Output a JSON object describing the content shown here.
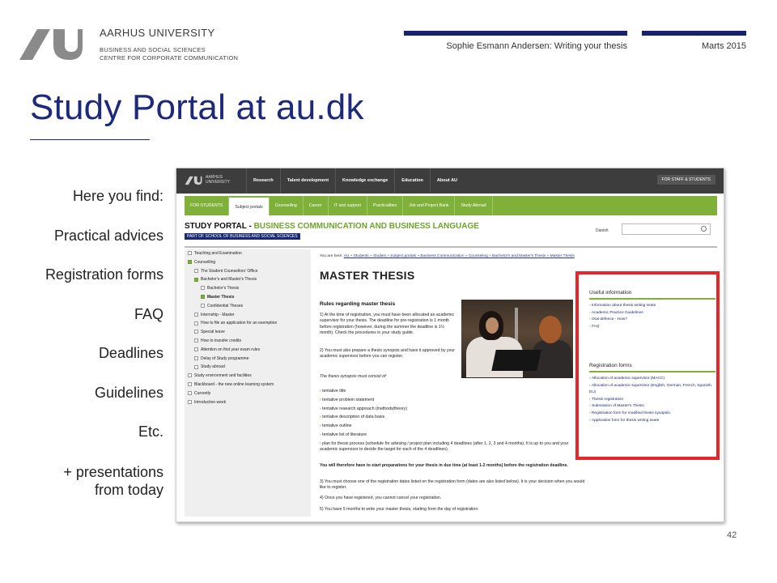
{
  "header": {
    "university": "AARHUS UNIVERSITY",
    "faculty_line1": "BUSINESS AND SOCIAL SCIENCES",
    "faculty_line2": "CENTRE FOR CORPORATE COMMUNICATION",
    "presenter": "Sophie Esmann Andersen: Writing your thesis",
    "date": "Marts 2015",
    "accent_color": "#15236e"
  },
  "slide": {
    "title": "Study Portal at au.dk",
    "title_color": "#1d2a7c",
    "page_number": "42",
    "highlight_color": "#e8262a"
  },
  "side_list": {
    "items": [
      "Here you find:",
      "Practical advices",
      "Registration forms",
      "FAQ",
      "Deadlines",
      "Guidelines",
      "Etc."
    ],
    "extra_line1": "+ presentations",
    "extra_line2": "from today"
  },
  "screenshot": {
    "uni_line1": "AARHUS",
    "uni_line2": "UNIVERSITY",
    "top_nav": [
      "Research",
      "Talent development",
      "Knowledge exchange",
      "Education",
      "About AU"
    ],
    "staff_link": "FOR STAFF & STUDENTS",
    "green_tabs": [
      "FOR STUDENTS",
      "Subject portals",
      "Counselling",
      "Career",
      "IT and support",
      "Practicalities",
      "Job and Project Bank",
      "Study Abroad"
    ],
    "active_tab_index": 1,
    "portal_prefix": "STUDY PORTAL - ",
    "portal_name": "BUSINESS COMMUNICATION AND BUSINESS LANGUAGE",
    "portal_sub": "PART OF SCHOOL OF BUSINESS AND SOCIAL SCIENCES",
    "lang_link": "Danish",
    "left_nav": [
      {
        "label": "Teaching and Examination",
        "indent": 0,
        "checked": false,
        "bold": false
      },
      {
        "label": "Counselling",
        "indent": 0,
        "checked": true,
        "bold": false
      },
      {
        "label": "The Student Counsellors' Office",
        "indent": 1,
        "checked": false,
        "bold": false
      },
      {
        "label": "Bachelor's and Master's Thesis",
        "indent": 1,
        "checked": true,
        "bold": false
      },
      {
        "label": "Bachelor's Thesis",
        "indent": 2,
        "checked": false,
        "bold": false
      },
      {
        "label": "Master Thesis",
        "indent": 2,
        "checked": true,
        "bold": true
      },
      {
        "label": "Confidential Theses",
        "indent": 2,
        "checked": false,
        "bold": false
      },
      {
        "label": "Internship - Master",
        "indent": 1,
        "checked": false,
        "bold": false
      },
      {
        "label": "How to file an application for an exemption",
        "indent": 1,
        "checked": false,
        "bold": false
      },
      {
        "label": "Special leave",
        "indent": 1,
        "checked": false,
        "bold": false
      },
      {
        "label": "How to transfer credits",
        "indent": 1,
        "checked": false,
        "bold": false
      },
      {
        "label": "Attention on first year exam rules",
        "indent": 1,
        "checked": false,
        "bold": false
      },
      {
        "label": "Delay of Study programme",
        "indent": 1,
        "checked": false,
        "bold": false
      },
      {
        "label": "Study abroad",
        "indent": 1,
        "checked": false,
        "bold": false
      },
      {
        "label": "Study environment and facilities",
        "indent": 0,
        "checked": false,
        "bold": false
      },
      {
        "label": "Blackboard - the new online learning system",
        "indent": 0,
        "checked": false,
        "bold": false
      },
      {
        "label": "Currently",
        "indent": 0,
        "checked": false,
        "bold": false
      },
      {
        "label": "Introduction week",
        "indent": 0,
        "checked": false,
        "bold": false
      }
    ],
    "breadcrumb_prefix": "You are here: ",
    "breadcrumb": "AU » Students » Studies » Subject portals » Business Communication » Counseling » Bachelor's and Master's Thesis » Master Thesis",
    "page_heading": "MASTER THESIS",
    "rules_heading": "Rules regarding master thesis",
    "rule1": "1) At the time of registration, you must have been allocated an academic supervisor for your thesis. The deadline for pre-registration is 1 month before registration (however, during the summer the deadline is 1½ month). Check the procedures in your study guide.",
    "rule2": "2) You must also prepare a thesis synopsis and have it approved by your academic supervisor before you can register.",
    "synopsis_intro": "The thesis synopsis must consist of:",
    "synopsis_items": [
      "tentative title",
      "tentative problem statement",
      "tentative research approach (methods/theory)",
      "tentative description of data basis",
      "tentative outline",
      "tentative list of literature",
      "plan for thesis process (schedule for advising / project plan including 4 deadlines (after 1, 2, 3 and 4 months). It is up to you and your academic supervisor to decide the target for each of the 4 deadlines)."
    ],
    "prep_note": "You will therefore have to start preparations for your thesis in due time (at least 1-2 months) before the registration deadline.",
    "rule3": "3) You must choose one of the registration dates listed on the registration form (dates are also listed below). It is your decision when you would like to register.",
    "rule4": "4) Once you have registered, you cannot cancel your registration.",
    "rule5": "5) You have 5 months to write your master thesis, starting from the day of registration.",
    "useful_title": "Useful information",
    "useful_links": [
      "Information about thesis writing seats",
      "Academic Practice Guidelines",
      "Oral defence - How?",
      "FAQ"
    ],
    "reg_title": "Registration forms",
    "reg_links": [
      "Allocation of academic supervisor (MACC)",
      "Allocation of academic supervisor (English, German, French, Spanish, EU)",
      "Thesis registration",
      "Submission of Master's Thesis",
      "Registration form for modified thesis synopsis",
      "Application form for thesis writing seats"
    ],
    "brand_green": "#7fb13a",
    "topbar_color": "#3d3d3d"
  }
}
